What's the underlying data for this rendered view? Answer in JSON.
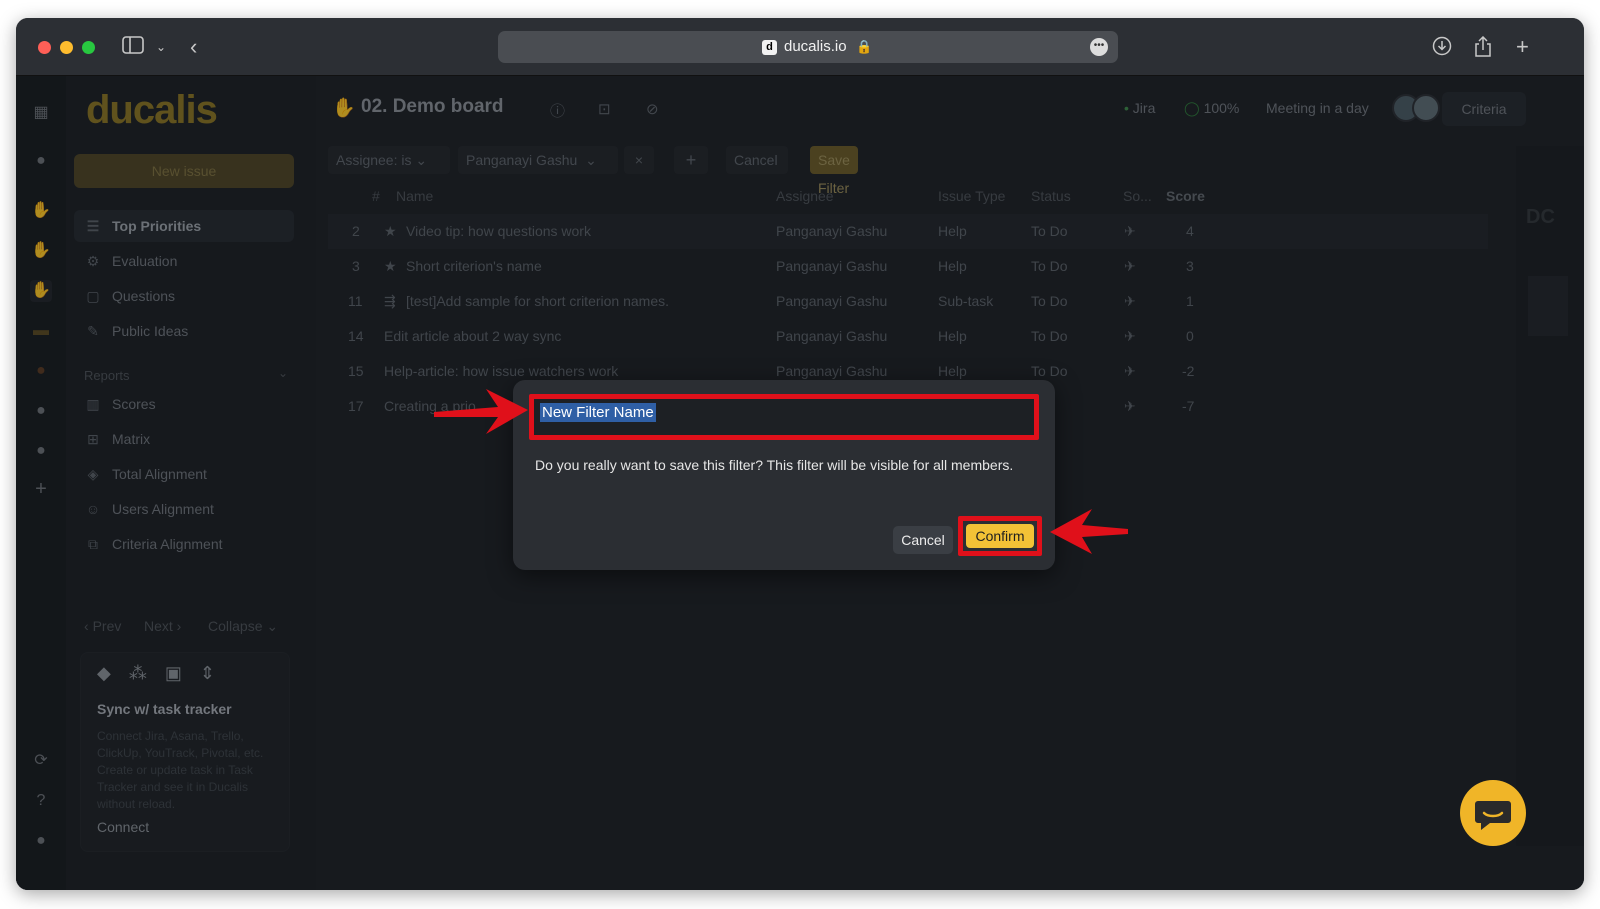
{
  "browser": {
    "url": "ducalis.io",
    "favicon_letter": "d"
  },
  "app": {
    "logo": "ducalis",
    "new_issue_label": "New issue",
    "nav": [
      {
        "label": "Top Priorities",
        "icon": "list-icon",
        "active": true
      },
      {
        "label": "Evaluation",
        "icon": "evaluation-icon"
      },
      {
        "label": "Questions",
        "icon": "questions-icon"
      },
      {
        "label": "Public Ideas",
        "icon": "public-ideas-icon"
      }
    ],
    "reports_heading": "Reports",
    "reports": [
      {
        "label": "Scores",
        "icon": "scores-icon"
      },
      {
        "label": "Matrix",
        "icon": "matrix-icon"
      },
      {
        "label": "Total Alignment",
        "icon": "layers-icon"
      },
      {
        "label": "Users Alignment",
        "icon": "users-icon"
      },
      {
        "label": "Criteria Alignment",
        "icon": "criteria-icon"
      }
    ],
    "pager": {
      "prev": "Prev",
      "next": "Next",
      "collapse": "Collapse"
    },
    "sync": {
      "title": "Sync w/ task tracker",
      "description": "Connect Jira, Asana, Trello, ClickUp, YouTrack, Pivotal, etc. Create or update task in Task Tracker and see it in Ducalis without reload.",
      "link": "Connect"
    }
  },
  "header": {
    "board_title": "02. Demo board",
    "integration": "Jira",
    "progress": "100%",
    "meeting": "Meeting in a day",
    "criteria_button": "Criteria"
  },
  "filter": {
    "field": "Assignee:",
    "operator": "is",
    "value": "Panganayi Gashu",
    "remove": "×",
    "add": "+",
    "cancel": "Cancel",
    "save": "Save Filter"
  },
  "table": {
    "columns": [
      "#",
      "Name",
      "Assignee",
      "Issue Type",
      "Status",
      "So...",
      "Score"
    ],
    "rows": [
      {
        "num": "2",
        "icon": "star-icon",
        "name": "Video tip: how questions work",
        "assignee": "Panganayi Gashu",
        "type": "Help",
        "status": "To Do",
        "score": "4"
      },
      {
        "num": "3",
        "icon": "star-icon",
        "name": "Short criterion's name",
        "assignee": "Panganayi Gashu",
        "type": "Help",
        "status": "To Do",
        "score": "3"
      },
      {
        "num": "11",
        "icon": "subtask-icon",
        "name": "[test]Add sample for short criterion names.",
        "assignee": "Panganayi Gashu",
        "type": "Sub-task",
        "status": "To Do",
        "score": "1"
      },
      {
        "num": "14",
        "icon": "",
        "name": "Edit article about 2 way sync",
        "assignee": "Panganayi Gashu",
        "type": "Help",
        "status": "To Do",
        "score": "0"
      },
      {
        "num": "15",
        "icon": "",
        "name": "Help-article: how issue watchers work",
        "assignee": "Panganayi Gashu",
        "type": "Help",
        "status": "To Do",
        "score": "-2"
      },
      {
        "num": "17",
        "icon": "",
        "name": "Creating a prio",
        "assignee": "",
        "type": "",
        "status": "",
        "score": "-7"
      }
    ]
  },
  "modal": {
    "input_value": "New Filter Name",
    "message": "Do you really want to save this filter? This filter will be visible for all members.",
    "cancel": "Cancel",
    "confirm": "Confirm"
  },
  "colors": {
    "accent": "#f3c236",
    "highlight_annotation": "#e0101a"
  }
}
